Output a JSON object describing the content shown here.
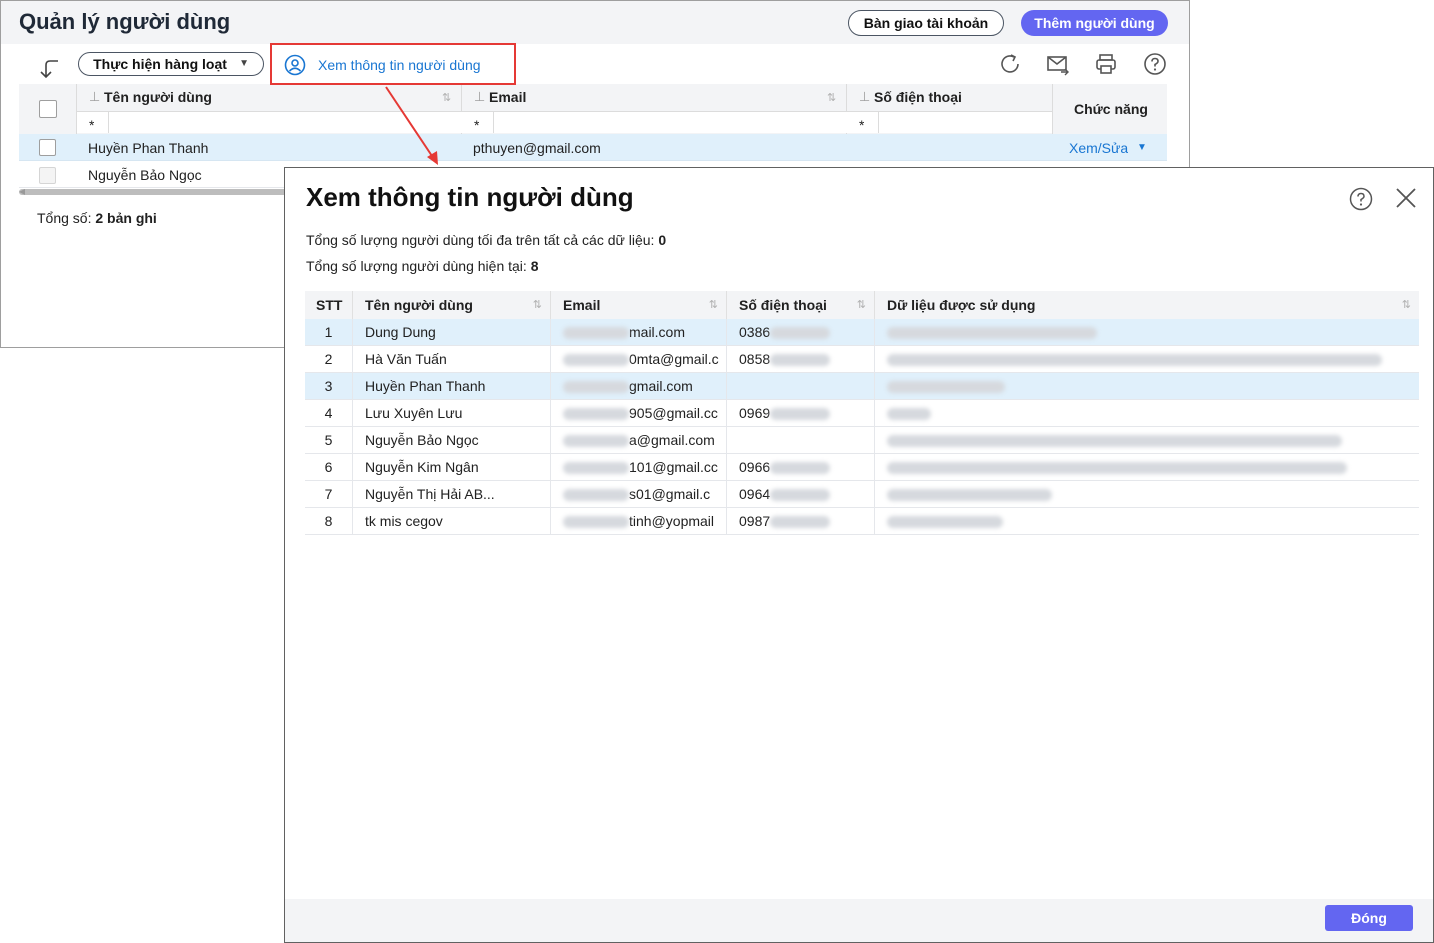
{
  "background": {
    "title": "Quản lý người dùng",
    "btn_handover": "Bàn giao tài khoản",
    "btn_add_user": "Thêm người dùng",
    "btn_bulk": "Thực hiện hàng loạt",
    "btn_view_info": "Xem thông tin người dùng",
    "columns": {
      "name": "Tên người dùng",
      "email": "Email",
      "phone": "Số điện thoại",
      "function": "Chức năng"
    },
    "filter_symbol": "*",
    "rows": [
      {
        "name": "Huyền Phan Thanh",
        "email": "pthuyen@gmail.com",
        "action": "Xem/Sửa"
      },
      {
        "name": "Nguyễn Bảo Ngọc"
      }
    ],
    "total_label": "Tổng số:",
    "total_value": "2 bản ghi"
  },
  "dialog": {
    "title": "Xem thông tin người dùng",
    "max_users_label": "Tổng số lượng người dùng tối đa trên tất cả các dữ liệu:",
    "max_users_value": "0",
    "current_users_label": "Tổng số lượng người dùng hiện tại:",
    "current_users_value": "8",
    "columns": {
      "stt": "STT",
      "name": "Tên người dùng",
      "email": "Email",
      "phone": "Số điện thoại",
      "data": "Dữ liệu được sử dụng"
    },
    "rows": [
      {
        "stt": "1",
        "name": "Dung Dung",
        "email": "mail.com",
        "phone": "0386"
      },
      {
        "stt": "2",
        "name": "Hà Văn Tuấn",
        "email": "0mta@gmail.c",
        "phone": "0858"
      },
      {
        "stt": "3",
        "name": "Huyền Phan Thanh",
        "email": "gmail.com",
        "phone": ""
      },
      {
        "stt": "4",
        "name": "Lưu Xuyên Lưu",
        "email": "905@gmail.cc",
        "phone": "0969"
      },
      {
        "stt": "5",
        "name": "Nguyễn Bảo Ngọc",
        "email": "a@gmail.com",
        "phone": ""
      },
      {
        "stt": "6",
        "name": "Nguyễn Kim Ngân",
        "email": "101@gmail.cc",
        "phone": "0966"
      },
      {
        "stt": "7",
        "name": "Nguyễn Thị Hải AB...",
        "email": "s01@gmail.c",
        "phone": "0964"
      },
      {
        "stt": "8",
        "name": "tk mis cegov",
        "email": "tinh@yopmail",
        "phone": "0987"
      }
    ],
    "close_label": "Đóng"
  },
  "colors": {
    "primary": "#6366f1",
    "highlight": "#e53935",
    "link": "#1976d2",
    "selected_row": "#e0f0fb"
  }
}
